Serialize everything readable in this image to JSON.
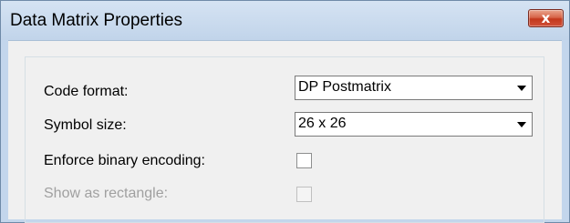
{
  "window": {
    "title": "Data Matrix Properties",
    "close_glyph": "x"
  },
  "form": {
    "code_format": {
      "label": "Code format:",
      "value": "DP Postmatrix"
    },
    "symbol_size": {
      "label": "Symbol size:",
      "value": "26  x 26"
    },
    "enforce_binary_encoding": {
      "label": "Enforce binary encoding:",
      "checked": false,
      "enabled": true
    },
    "show_as_rectangle": {
      "label": "Show as rectangle:",
      "checked": false,
      "enabled": false
    }
  },
  "colors": {
    "titlebar": "#c9daee",
    "close_button": "#c7452a",
    "client_background": "#f0f0f0",
    "disabled_text": "#a0a0a0"
  },
  "icons": {
    "close": "close-icon",
    "dropdown": "chevron-down-icon"
  }
}
